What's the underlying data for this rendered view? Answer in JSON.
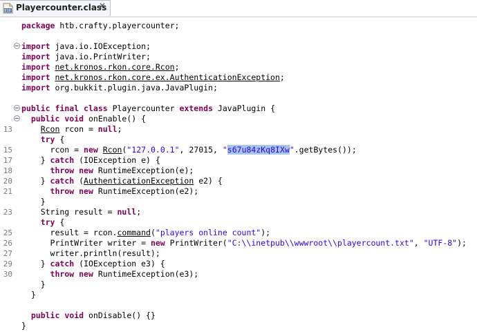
{
  "tab": {
    "title": "Playercounter.class",
    "icon": "class-file-icon",
    "close_icon": "close-icon"
  },
  "editor": {
    "lines": [
      {
        "num": "",
        "fold": false,
        "tokens": [
          {
            "t": "package",
            "c": "kw"
          },
          {
            "t": " htb.crafty.playercounter;"
          }
        ]
      },
      {
        "num": "",
        "fold": false,
        "tokens": []
      },
      {
        "num": "",
        "fold": true,
        "tokens": [
          {
            "t": "import",
            "c": "kw"
          },
          {
            "t": " java.io.IOException;"
          }
        ]
      },
      {
        "num": "",
        "fold": false,
        "tokens": [
          {
            "t": "import",
            "c": "kw"
          },
          {
            "t": " java.io.PrintWriter;"
          }
        ]
      },
      {
        "num": "",
        "fold": false,
        "tokens": [
          {
            "t": "import",
            "c": "kw"
          },
          {
            "t": " "
          },
          {
            "t": "net.kronos.rkon.core.Rcon",
            "c": "ul"
          },
          {
            "t": ";"
          }
        ]
      },
      {
        "num": "",
        "fold": false,
        "tokens": [
          {
            "t": "import",
            "c": "kw"
          },
          {
            "t": " "
          },
          {
            "t": "net.kronos.rkon.core.ex.AuthenticationException",
            "c": "ul"
          },
          {
            "t": ";"
          }
        ]
      },
      {
        "num": "",
        "fold": false,
        "tokens": [
          {
            "t": "import",
            "c": "kw"
          },
          {
            "t": " org.bukkit.plugin.java.JavaPlugin;"
          }
        ]
      },
      {
        "num": "",
        "fold": false,
        "tokens": []
      },
      {
        "num": "",
        "fold": true,
        "tokens": [
          {
            "t": "public",
            "c": "kw"
          },
          {
            "t": " "
          },
          {
            "t": "final",
            "c": "kw"
          },
          {
            "t": " "
          },
          {
            "t": "class",
            "c": "kw"
          },
          {
            "t": " Playercounter "
          },
          {
            "t": "extends",
            "c": "kw"
          },
          {
            "t": " JavaPlugin {"
          }
        ]
      },
      {
        "num": "",
        "fold": true,
        "tokens": [
          {
            "t": "  "
          },
          {
            "t": "public",
            "c": "kw"
          },
          {
            "t": " "
          },
          {
            "t": "void",
            "c": "kw"
          },
          {
            "t": " onEnable() {"
          }
        ]
      },
      {
        "num": "13",
        "fold": false,
        "tokens": [
          {
            "t": "    "
          },
          {
            "t": "Rcon",
            "c": "ul"
          },
          {
            "t": " rcon = "
          },
          {
            "t": "null",
            "c": "kw"
          },
          {
            "t": ";"
          }
        ]
      },
      {
        "num": "",
        "fold": false,
        "tokens": [
          {
            "t": "    "
          },
          {
            "t": "try",
            "c": "kw"
          },
          {
            "t": " {"
          }
        ]
      },
      {
        "num": "15",
        "fold": false,
        "tokens": [
          {
            "t": "      rcon = "
          },
          {
            "t": "new",
            "c": "kw"
          },
          {
            "t": " "
          },
          {
            "t": "Rcon",
            "c": "ul"
          },
          {
            "t": "("
          },
          {
            "t": "\"127.0.0.1\"",
            "c": "str"
          },
          {
            "t": ", 27015, "
          },
          {
            "t": "\"",
            "c": "str"
          },
          {
            "t": "s67u84zKq8IXw",
            "c": "str sel"
          },
          {
            "t": "\"",
            "c": "str"
          },
          {
            "t": ".getBytes());"
          }
        ]
      },
      {
        "num": "17",
        "fold": false,
        "tokens": [
          {
            "t": "    } "
          },
          {
            "t": "catch",
            "c": "kw"
          },
          {
            "t": " (IOException e) {"
          }
        ]
      },
      {
        "num": "18",
        "fold": false,
        "tokens": [
          {
            "t": "      "
          },
          {
            "t": "throw",
            "c": "kw"
          },
          {
            "t": " "
          },
          {
            "t": "new",
            "c": "kw"
          },
          {
            "t": " RuntimeException(e);"
          }
        ]
      },
      {
        "num": "20",
        "fold": false,
        "tokens": [
          {
            "t": "    } "
          },
          {
            "t": "catch",
            "c": "kw"
          },
          {
            "t": " ("
          },
          {
            "t": "AuthenticationException",
            "c": "ul"
          },
          {
            "t": " e2) {"
          }
        ]
      },
      {
        "num": "21",
        "fold": false,
        "tokens": [
          {
            "t": "      "
          },
          {
            "t": "throw",
            "c": "kw"
          },
          {
            "t": " "
          },
          {
            "t": "new",
            "c": "kw"
          },
          {
            "t": " RuntimeException(e2);"
          }
        ]
      },
      {
        "num": "",
        "fold": false,
        "tokens": [
          {
            "t": "    }"
          }
        ]
      },
      {
        "num": "23",
        "fold": false,
        "tokens": [
          {
            "t": "    String result = "
          },
          {
            "t": "null",
            "c": "kw"
          },
          {
            "t": ";"
          }
        ]
      },
      {
        "num": "",
        "fold": false,
        "tokens": [
          {
            "t": "    "
          },
          {
            "t": "try",
            "c": "kw"
          },
          {
            "t": " {"
          }
        ]
      },
      {
        "num": "25",
        "fold": false,
        "tokens": [
          {
            "t": "      result = rcon."
          },
          {
            "t": "command",
            "c": "ul"
          },
          {
            "t": "("
          },
          {
            "t": "\"players online count\"",
            "c": "str"
          },
          {
            "t": ");"
          }
        ]
      },
      {
        "num": "26",
        "fold": false,
        "tokens": [
          {
            "t": "      PrintWriter writer = "
          },
          {
            "t": "new",
            "c": "kw"
          },
          {
            "t": " PrintWriter("
          },
          {
            "t": "\"C:\\\\inetpub\\\\wwwroot\\\\playercount.txt\"",
            "c": "str"
          },
          {
            "t": ", "
          },
          {
            "t": "\"UTF-8\"",
            "c": "str"
          },
          {
            "t": ");"
          }
        ]
      },
      {
        "num": "27",
        "fold": false,
        "tokens": [
          {
            "t": "      writer.println(result);"
          }
        ]
      },
      {
        "num": "29",
        "fold": false,
        "tokens": [
          {
            "t": "    } "
          },
          {
            "t": "catch",
            "c": "kw"
          },
          {
            "t": " (IOException e3) {"
          }
        ]
      },
      {
        "num": "30",
        "fold": false,
        "tokens": [
          {
            "t": "      "
          },
          {
            "t": "throw",
            "c": "kw"
          },
          {
            "t": " "
          },
          {
            "t": "new",
            "c": "kw"
          },
          {
            "t": " RuntimeException(e3);"
          }
        ]
      },
      {
        "num": "",
        "fold": false,
        "tokens": [
          {
            "t": "    }"
          }
        ]
      },
      {
        "num": "",
        "fold": false,
        "tokens": [
          {
            "t": "  }"
          }
        ]
      },
      {
        "num": "",
        "fold": false,
        "tokens": []
      },
      {
        "num": "",
        "fold": false,
        "tokens": [
          {
            "t": "  "
          },
          {
            "t": "public",
            "c": "kw"
          },
          {
            "t": " "
          },
          {
            "t": "void",
            "c": "kw"
          },
          {
            "t": " onDisable() {}"
          }
        ]
      },
      {
        "num": "",
        "fold": false,
        "tokens": [
          {
            "t": "}"
          }
        ]
      }
    ]
  },
  "colors": {
    "keyword": "#7f0055",
    "string": "#2a00ff",
    "selection": "#a6c6e6"
  }
}
